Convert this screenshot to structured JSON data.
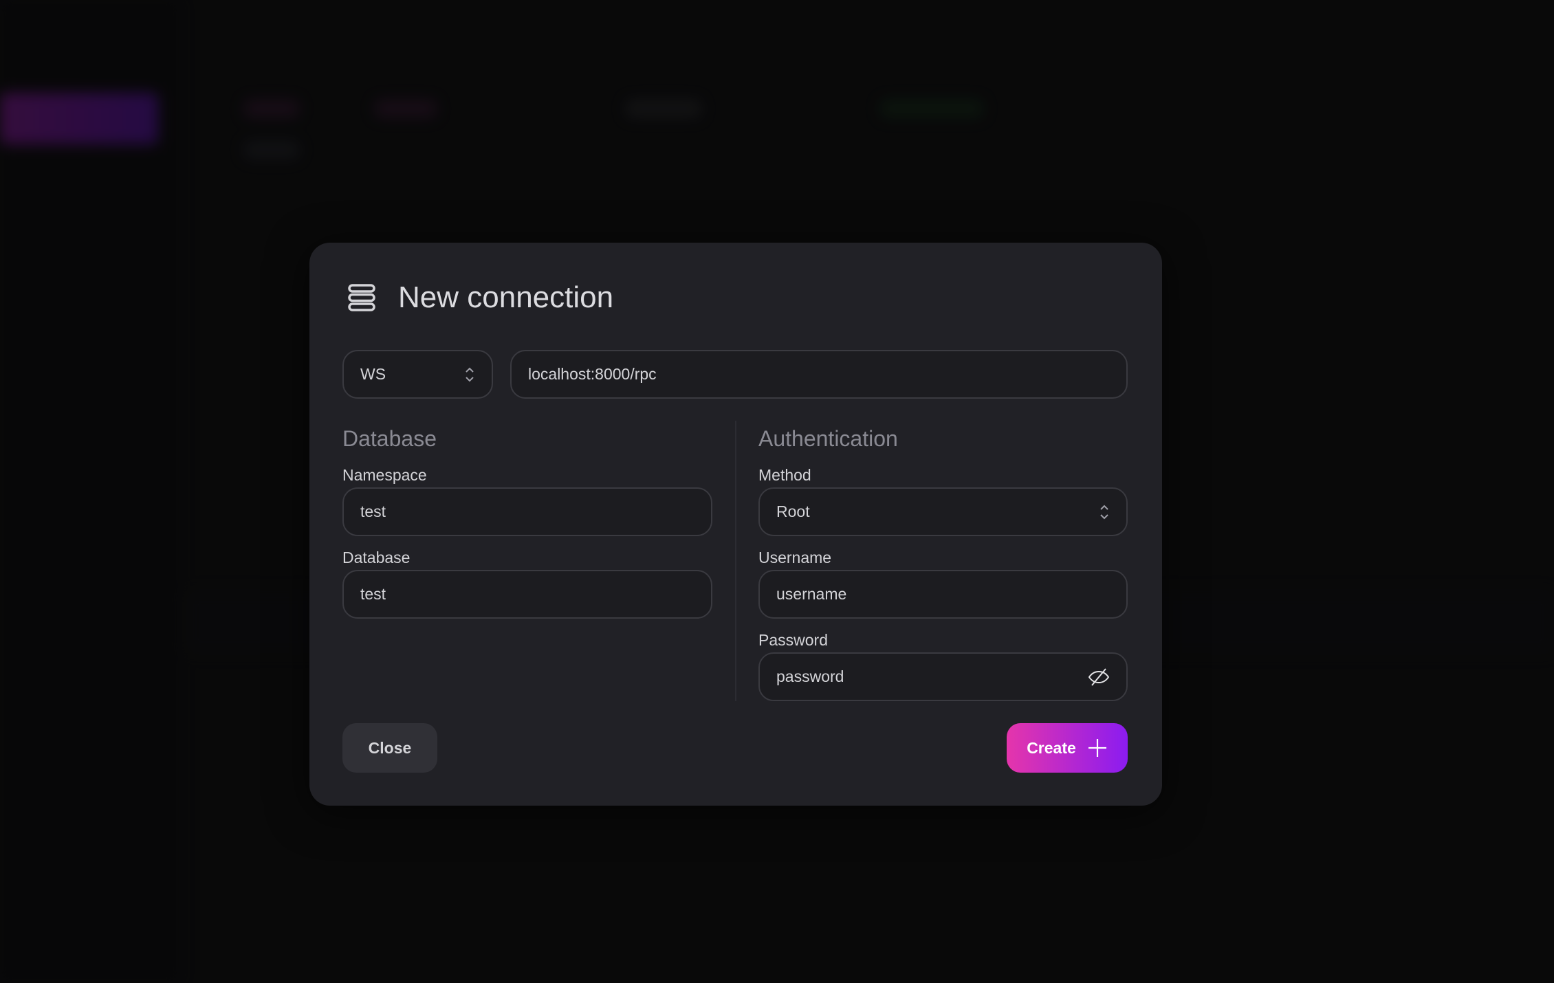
{
  "modal": {
    "title": "New connection",
    "title_icon": "server-stack-icon",
    "protocol": "WS",
    "endpoint": "localhost:8000/rpc",
    "database_section": {
      "heading": "Database",
      "namespace_label": "Namespace",
      "namespace_value": "test",
      "database_label": "Database",
      "database_value": "test"
    },
    "auth_section": {
      "heading": "Authentication",
      "method_label": "Method",
      "method_value": "Root",
      "username_label": "Username",
      "username_placeholder": "username",
      "password_label": "Password",
      "password_placeholder": "password"
    },
    "close_label": "Close",
    "create_label": "Create",
    "accent_gradient": [
      "#e535ab",
      "#8b1cf0"
    ]
  }
}
